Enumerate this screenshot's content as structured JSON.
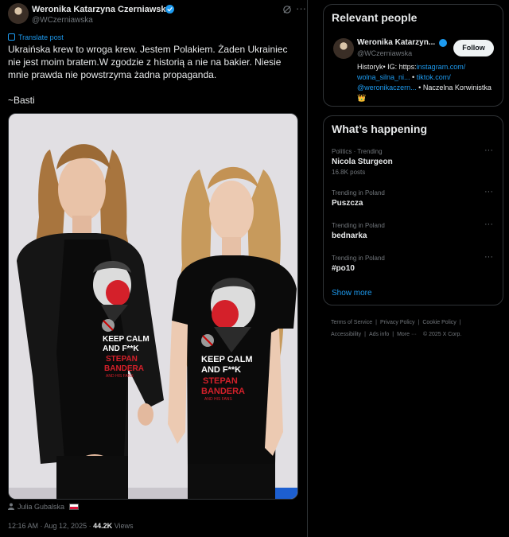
{
  "post": {
    "author_name": "Weronika Katarzyna Czerniawska",
    "author_handle": "@WCzerniawska",
    "translate_label": "Translate post",
    "text": "Ukraińska krew to wroga krew. Jestem Polakiem. Żaden Ukrainiec nie jest moim bratem.W zgodzie z historią a nie na bakier. Niesie mnie prawda nie powstrzyma żadna propaganda.",
    "signature": "~Basti",
    "photo_credit": "Julia Gubalska",
    "timestamp": "12:16 AM · Aug 12, 2025 ·",
    "views_count": "44.2K",
    "views_label": "Views",
    "shirt_text": {
      "left": [
        "KEEP CALM",
        "AND F**K",
        "STEPAN",
        "BANDERA",
        "AND HIS FANS"
      ],
      "right": [
        "KEEP CALM",
        "AND F**K",
        "STEPAN",
        "BANDERA",
        "AND HIS FANS"
      ]
    }
  },
  "relevant_people": {
    "title": "Relevant people",
    "name": "Weronika Katarzyn...",
    "handle": "@WCzerniawska",
    "follow_label": "Follow",
    "bio_prefix": "Historyk• IG: https:",
    "bio_link1": "instagram.com/ wolna_silna_ni...",
    "bio_mid1": " • ",
    "bio_link2": "tiktok.com/ @weronikaczern...",
    "bio_suffix": " • Naczelna Korwinistka 👑"
  },
  "whats_happening": {
    "title": "What’s happening",
    "trends": [
      {
        "meta": "Politics · Trending",
        "name": "Nicola Sturgeon",
        "posts": "16.8K posts"
      },
      {
        "meta": "Trending in Poland",
        "name": "Puszcza",
        "posts": ""
      },
      {
        "meta": "Trending in Poland",
        "name": "bednarka",
        "posts": ""
      },
      {
        "meta": "Trending in Poland",
        "name": "#po10",
        "posts": ""
      }
    ],
    "show_more": "Show more"
  },
  "footer": {
    "links": [
      "Terms of Service",
      "Privacy Policy",
      "Cookie Policy",
      "Accessibility",
      "Ads info",
      "More ···",
      "© 2025 X Corp."
    ]
  },
  "colors": {
    "background": "#000000",
    "text": "#e7e9ea",
    "secondary": "#71767b",
    "accent": "#1d9bf0",
    "border": "#2f3336"
  }
}
